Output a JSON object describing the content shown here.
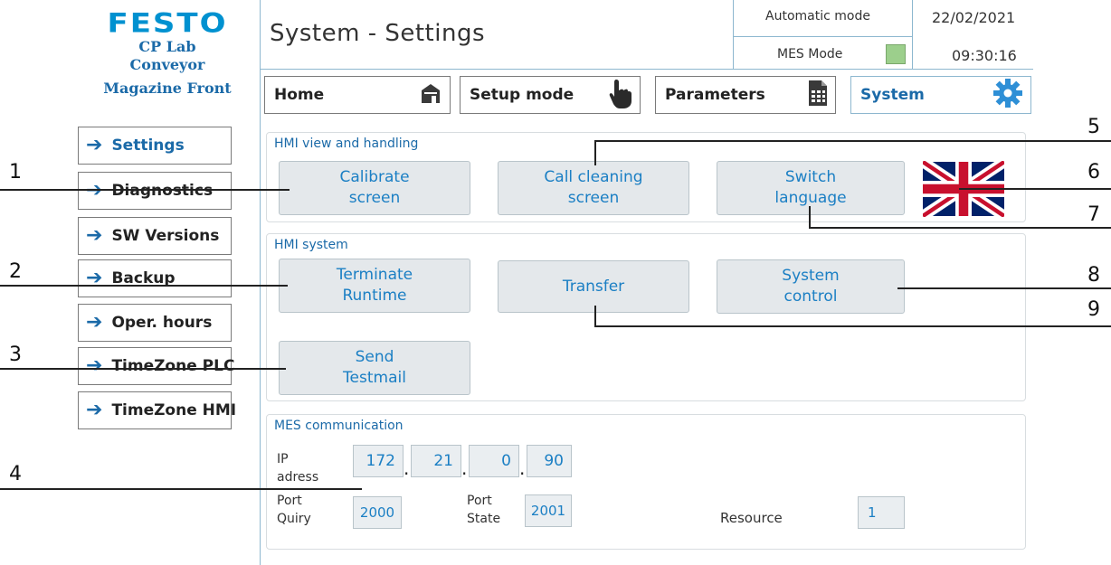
{
  "brand": {
    "logo_text": "FESTO",
    "line1": "CP Lab",
    "line2": "Conveyor",
    "line3": "Magazine Front"
  },
  "header": {
    "title": "System - Settings",
    "automatic_mode": "Automatic mode",
    "mes_mode": "MES Mode",
    "mes_mode_indicator_color": "#9ccf8c",
    "date": "22/02/2021",
    "time": "09:30:16"
  },
  "nav": {
    "home": "Home",
    "setup_mode": "Setup mode",
    "parameters": "Parameters",
    "system": "System"
  },
  "sidebar": {
    "items": [
      {
        "label": "Settings",
        "active": true
      },
      {
        "label": "Diagnostics"
      },
      {
        "label": "SW Versions"
      },
      {
        "label": "Backup"
      },
      {
        "label": "Oper. hours"
      },
      {
        "label": "TimeZone PLC"
      },
      {
        "label": "TimeZone HMI"
      }
    ]
  },
  "hmi_view": {
    "title": "HMI view and handling",
    "calibrate": [
      "Calibrate",
      "screen"
    ],
    "cleaning": [
      "Call cleaning",
      "screen"
    ],
    "switch_language": [
      "Switch",
      "language"
    ]
  },
  "hmi_system": {
    "title": "HMI system",
    "terminate": [
      "Terminate",
      "Runtime"
    ],
    "transfer": "Transfer",
    "system_control": [
      "System",
      "control"
    ],
    "send_testmail": [
      "Send",
      "Testmail"
    ]
  },
  "mes": {
    "title": "MES communication",
    "ip_label": [
      "IP",
      "adress"
    ],
    "ip": [
      "172",
      "21",
      "0",
      "90"
    ],
    "ip_dot": ".",
    "port_quiry_label": [
      "Port",
      "Quiry"
    ],
    "port_quiry": "2000",
    "port_state_label": [
      "Port",
      "State"
    ],
    "port_state": "2001",
    "resource_label": "Resource",
    "resource": "1"
  },
  "callouts": [
    "1",
    "2",
    "3",
    "4",
    "5",
    "6",
    "7",
    "8",
    "9"
  ],
  "colors": {
    "accent": "#1b6aa8",
    "brand_blue": "#0091d0",
    "button_bg": "#e4e8eb",
    "button_text": "#1b7fc4"
  }
}
